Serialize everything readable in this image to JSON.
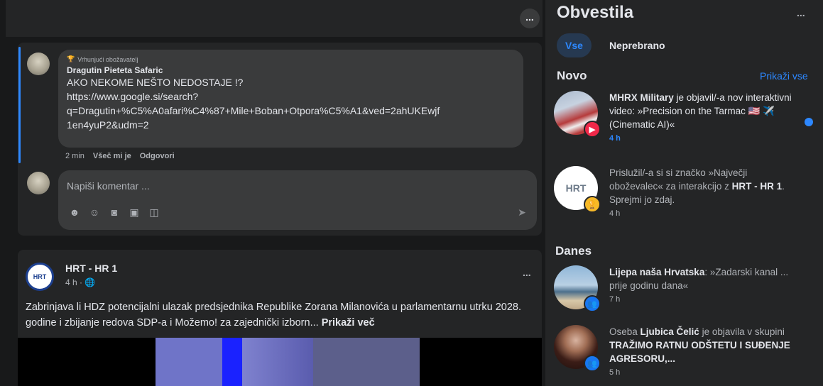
{
  "feed": {
    "topbar_more": "...",
    "comment": {
      "badge": "Vrhunjući obožavatelj",
      "author": "Dragutin Pieteta Safaric",
      "text_line1": "AKO NEKOME NEŠTO NEDOSTAJE !?",
      "text_line2": "https://www.google.si/search?",
      "text_line3": "q=Dragutin+%C5%A0afari%C4%87+Mile+Boban+Otpora%C5%A1&ved=2ahUKEwjf",
      "text_line4": "1en4yuP2&udm=2",
      "time": "2 min",
      "like": "Všeč mi je",
      "reply": "Odgovori"
    },
    "write_comment": {
      "placeholder": "Napiši komentar ..."
    },
    "post": {
      "page_name": "HRT - HR 1",
      "page_avatar_text": "HRT",
      "meta": "4 h · 🌐",
      "more": "...",
      "text": "Zabrinjava li HDZ potencijalni ulazak predsjednika Republike Zorana Milanovića u parlamentarnu utrku 2028. godine i zbijanje redova SDP-a i Možemo! za zajednički izborn... ",
      "see_more": "Prikaži več"
    }
  },
  "notifications": {
    "title": "Obvestila",
    "more": "...",
    "tabs": [
      {
        "label": "Vse"
      },
      {
        "label": "Neprebrano"
      }
    ],
    "section_new": "Novo",
    "see_all": "Prikaži vse",
    "section_today": "Danes",
    "items": [
      {
        "actor": "MHRX Military",
        "text": " je objavil/-a nov interaktivni video: »Precision on the Tarmac 🇺🇸 ✈️ (Cinematic AI)«",
        "time": "4 h",
        "badge_icon": "▶"
      },
      {
        "pre": "Prislužil/-a si si značko »Največji oboževalec« za interakcijo z ",
        "actor": "HRT - HR 1",
        "text": ". Sprejmi jo zdaj.",
        "time": "4 h",
        "avatar_text": "HRT",
        "badge_icon": "🏆"
      },
      {
        "actor": "Lijepa naša Hrvatska",
        "text": ": »Zadarski kanal ... prije godinu dana«",
        "time": "7 h",
        "badge_icon": "👥"
      },
      {
        "pre": "Oseba ",
        "actor": "Ljubica Čelić",
        "mid": " je objavila v skupini ",
        "group": "TRAŽIMO RATNU ODŠTETU I SUĐENJE AGRESORU,...",
        "time": "5 h",
        "badge_icon": "👥"
      }
    ]
  },
  "colors": {
    "accent": "#2d88ff",
    "panel": "#242526",
    "background": "#18191a",
    "bubble": "#3a3b3c"
  }
}
